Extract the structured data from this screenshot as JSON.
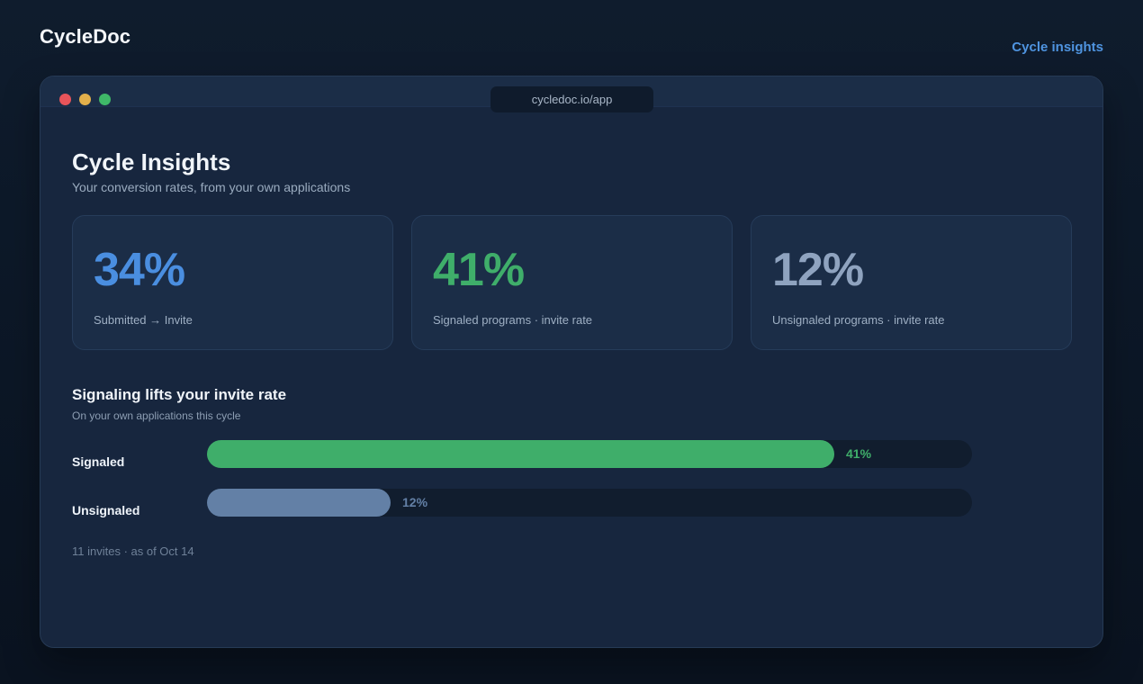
{
  "app": {
    "brand": "CycleDoc",
    "nav_link": "Cycle insights",
    "url": "cycledoc.io/app"
  },
  "page": {
    "title": "Cycle Insights",
    "subtitle": "Your conversion rates, from your own applications"
  },
  "stats": [
    {
      "value": "34%",
      "label": "Submitted → Invite",
      "color": "#4a8ee0"
    },
    {
      "value": "41%",
      "label": "Signaled programs · invite rate",
      "color": "#3fae6a"
    },
    {
      "value": "12%",
      "label": "Unsignaled programs · invite rate",
      "color": "#8fa3bf"
    }
  ],
  "comparison": {
    "title": "Signaling lifts your invite rate",
    "subtitle": "On your own applications this cycle",
    "bars": [
      {
        "label": "Signaled",
        "value": 41,
        "display": "41%",
        "color": "#3fae6a"
      },
      {
        "label": "Unsignaled",
        "value": 12,
        "display": "12%",
        "color": "#6380a6"
      }
    ],
    "scale_max": 50
  },
  "footnote": "11 invites · as of Oct 14",
  "icons": {
    "window_controls": [
      "close-dot",
      "minimize-dot",
      "maximize-dot"
    ]
  }
}
